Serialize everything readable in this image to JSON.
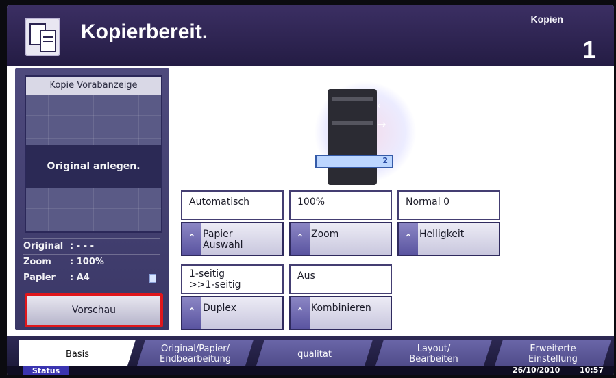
{
  "header": {
    "title": "Kopierbereit.",
    "copies_label": "Kopien",
    "copies_value": "1"
  },
  "preview": {
    "title": "Kopie Vorabanzeige",
    "message": "Original anlegen.",
    "info": [
      {
        "key": "Original",
        "value": ": - - -"
      },
      {
        "key": "Zoom",
        "value": ": 100%"
      },
      {
        "key": "Papier",
        "value": ": A4"
      }
    ],
    "button_label": "Vorschau"
  },
  "machine": {
    "tray_number": "2"
  },
  "settings": [
    {
      "value": "Automatisch",
      "button_label": "Papier\nAuswahl"
    },
    {
      "value": "100%",
      "button_label": "Zoom"
    },
    {
      "value": "Normal 0",
      "button_label": "Helligkeit"
    },
    {
      "value": "1-seitig\n>>1-seitig",
      "button_label": "Duplex"
    },
    {
      "value": "Aus",
      "button_label": "Kombinieren"
    }
  ],
  "tabs": [
    {
      "label": "Basis",
      "active": true
    },
    {
      "label": "Original/Papier/\nEndbearbeitung",
      "active": false
    },
    {
      "label": "qualitat",
      "active": false
    },
    {
      "label": "Layout/\nBearbeiten",
      "active": false
    },
    {
      "label": "Erweiterte\nEinstellung",
      "active": false
    }
  ],
  "status": {
    "button_label": "Status",
    "date": "26/10/2010",
    "time": "10:57"
  },
  "colors": {
    "header": "#2a2150",
    "highlight_border": "#e0161b",
    "tile_border": "#443e72"
  }
}
